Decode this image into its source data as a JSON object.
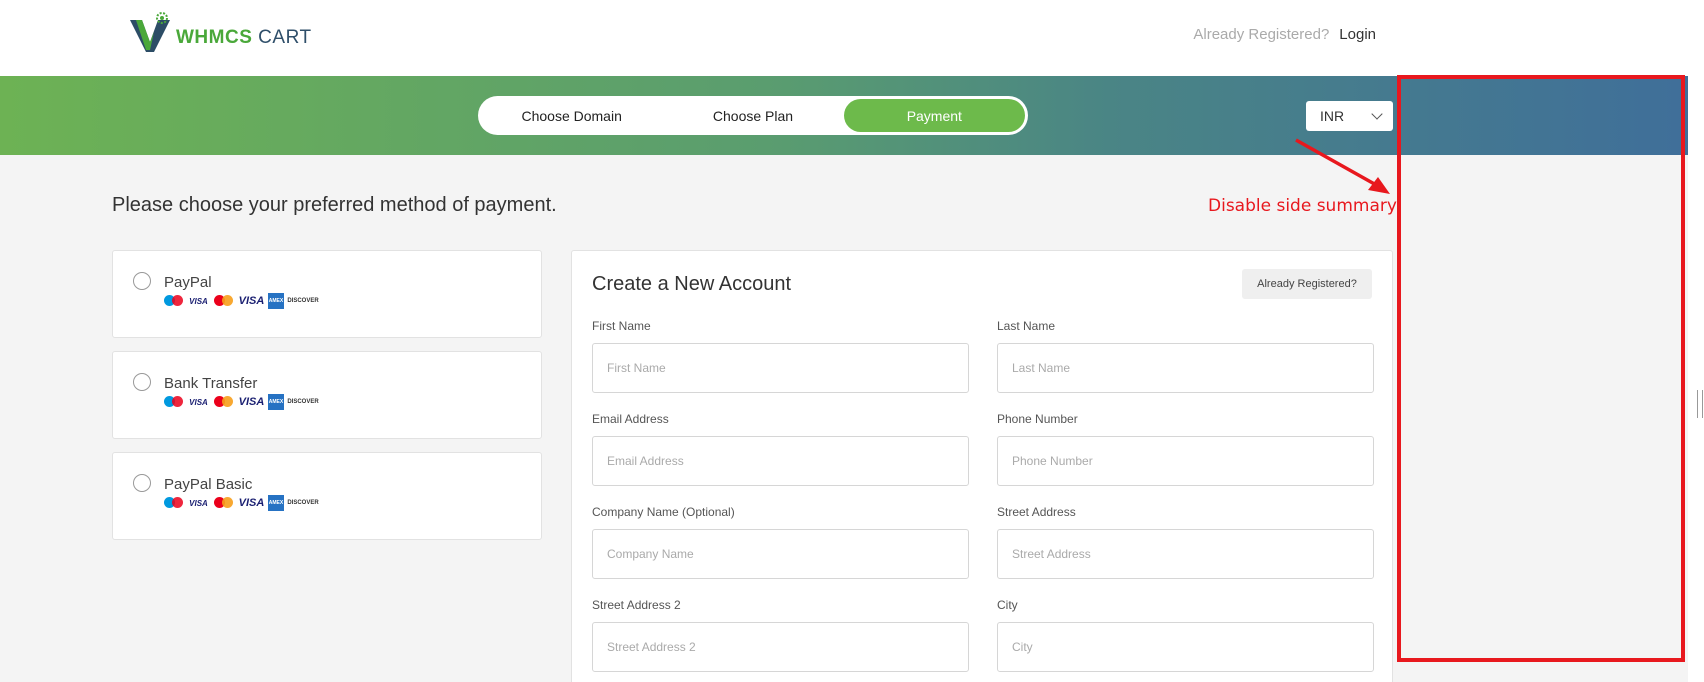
{
  "header": {
    "logo_word_bold": "WHMCS",
    "logo_word_normal": " CART",
    "already_registered": "Already Registered?",
    "login": "Login"
  },
  "steps": [
    {
      "label": "Choose Domain",
      "active": false
    },
    {
      "label": "Choose Plan",
      "active": false
    },
    {
      "label": "Payment",
      "active": true
    }
  ],
  "currency": {
    "selected": "INR"
  },
  "main": {
    "title": "Please choose your preferred method of payment."
  },
  "annotation": {
    "text": "Disable side summary",
    "color": "#e8181e"
  },
  "payment_methods": [
    {
      "name": "PayPal",
      "cards": [
        "maestro",
        "visa-electron",
        "mastercard",
        "visa",
        "amex",
        "discover"
      ]
    },
    {
      "name": "Bank Transfer",
      "cards": [
        "maestro",
        "visa-electron",
        "mastercard",
        "visa",
        "amex",
        "discover"
      ]
    },
    {
      "name": "PayPal Basic",
      "cards": [
        "maestro",
        "visa-electron",
        "mastercard",
        "visa",
        "amex",
        "discover"
      ]
    }
  ],
  "card_labels": {
    "visa": "VISA",
    "amex": "AMEX",
    "discover": "DISCOVER"
  },
  "account": {
    "title": "Create a New Account",
    "already_registered_button": "Already Registered?",
    "fields": {
      "first_name": {
        "label": "First Name",
        "placeholder": "First Name"
      },
      "last_name": {
        "label": "Last Name",
        "placeholder": "Last Name"
      },
      "email": {
        "label": "Email Address",
        "placeholder": "Email Address"
      },
      "phone": {
        "label": "Phone Number",
        "placeholder": "Phone Number"
      },
      "company": {
        "label": "Company Name (Optional)",
        "placeholder": "Company Name"
      },
      "street": {
        "label": "Street Address",
        "placeholder": "Street Address"
      },
      "street2": {
        "label": "Street Address 2",
        "placeholder": "Street Address 2"
      },
      "city": {
        "label": "City",
        "placeholder": "City"
      }
    }
  },
  "colors": {
    "accent_green": "#6dba4b",
    "banner_start": "#6db254",
    "banner_end": "#3f6e9a"
  }
}
